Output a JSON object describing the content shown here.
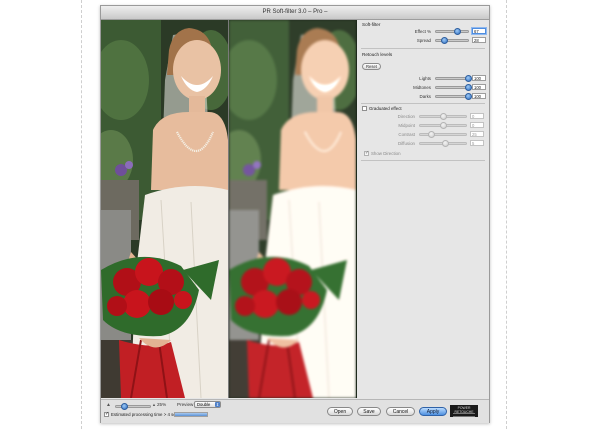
{
  "window": {
    "title": "PR Soft-filter 3.0 – Pro –"
  },
  "panel": {
    "soft_filter": {
      "title": "Soft-filter",
      "effect": {
        "label": "Effect %",
        "value": "67",
        "fraction": 0.67
      },
      "spread": {
        "label": "Spread",
        "value": "28",
        "fraction": 0.28
      }
    },
    "retouch": {
      "title": "Retouch levels",
      "reset_label": "Reset",
      "lights": {
        "label": "Lights",
        "value": "100",
        "fraction": 1.0
      },
      "midtones": {
        "label": "Midtones",
        "value": "100",
        "fraction": 1.0
      },
      "darks": {
        "label": "Darks",
        "value": "100",
        "fraction": 1.0
      }
    },
    "graduated": {
      "label": "Graduated effect",
      "checked": false,
      "direction": {
        "label": "Direction",
        "value": "0",
        "fraction": 0.5
      },
      "midpoint": {
        "label": "Midpoint",
        "value": "0",
        "fraction": 0.5
      },
      "contrast": {
        "label": "Contrast",
        "value": "25",
        "fraction": 0.25
      },
      "diffusion": {
        "label": "Diffusion",
        "value": "5",
        "fraction": 0.55
      },
      "show_direction_label": "Show Direction",
      "show_direction_checked": true
    }
  },
  "bottom": {
    "zoom_percent": "25%",
    "zoom_fraction": 0.25,
    "preview_label": "Preview",
    "preview_mode": "Double",
    "estimated_label": "Estimated processing time > 4 sec.",
    "estimated_checked": true,
    "progress_fraction": 1.0,
    "buttons": {
      "open": "Open",
      "save": "Save",
      "cancel": "Cancel",
      "apply": "Apply"
    },
    "logo_text": "POWER RETOUCHE"
  },
  "colors": {
    "accent": "#3b7fd8",
    "panel_bg": "#e6e6e6",
    "roses": "#c8141c",
    "dress": "#f1ece4",
    "foliage": "#2f4a26"
  },
  "icons": {
    "zoom_out": "mountain-small-icon",
    "zoom_in": "mountain-large-icon",
    "select": "chevron-updown-icon",
    "check": "checkmark-icon"
  }
}
